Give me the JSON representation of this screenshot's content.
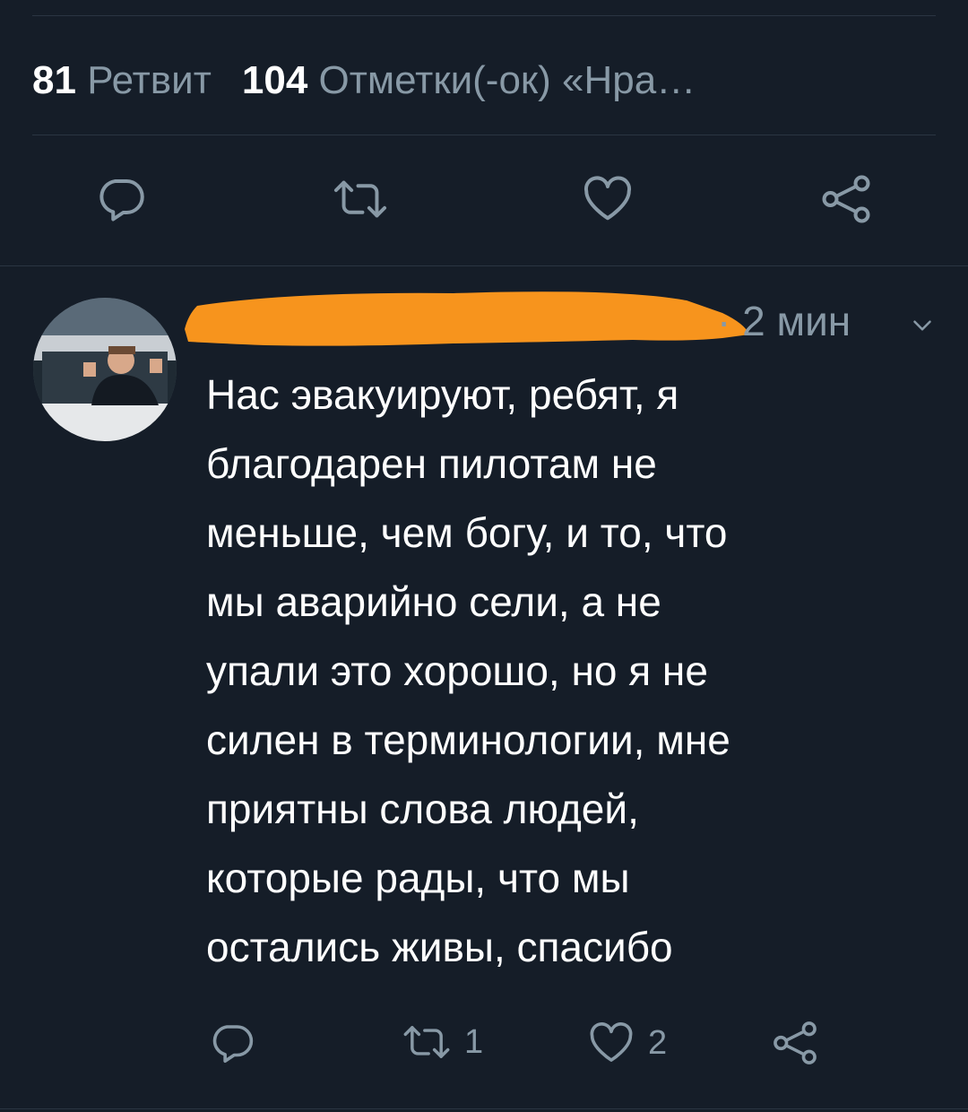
{
  "stats": {
    "retweet_count": "81",
    "retweet_label": "Ретвит",
    "like_count": "104",
    "like_label": "Отметки(-ок) «Нра…"
  },
  "main_actions": {
    "reply_icon": "reply-icon",
    "retweet_icon": "retweet-icon",
    "like_icon": "heart-icon",
    "share_icon": "share-icon"
  },
  "reply_tweet": {
    "time": "· 2 мин",
    "text_lines": [
      "Нас эвакуируют, ребят, я",
      "благодарен пилотам не",
      "меньше, чем богу, и то, что",
      "мы аварийно сели, а не",
      "упали это хорошо, но я не",
      "силен в терминологии, мне",
      "приятны слова людей,",
      "которые рады, что мы",
      "остались живы, спасибо"
    ],
    "retweet_count": "1",
    "like_count": "2"
  },
  "colors": {
    "background": "#151d28",
    "muted": "#8899a6",
    "divider": "#2a3542",
    "redaction": "#f7941d"
  }
}
